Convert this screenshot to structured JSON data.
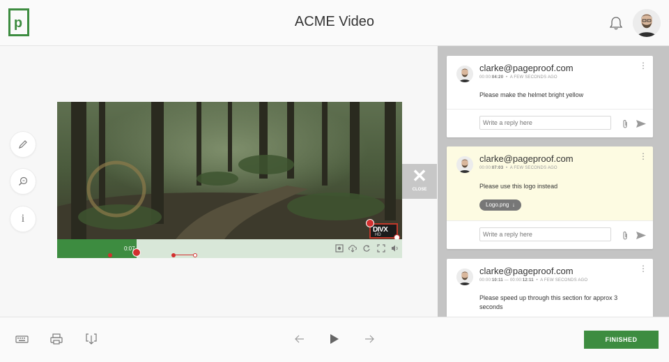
{
  "header": {
    "logo_letter": "p",
    "title": "ACME Video",
    "bell_icon": "bell-icon",
    "avatar_icon": "user-avatar"
  },
  "tools": [
    {
      "name": "pencil-icon"
    },
    {
      "name": "zoom-icon"
    },
    {
      "name": "info-icon"
    }
  ],
  "tools_info_glyph": "i",
  "video": {
    "current_time": "0:07",
    "progress_fraction": 0.23,
    "watermark_main": "DIVX",
    "watermark_sub": "HD",
    "controls": [
      "screenshot-icon",
      "download-icon",
      "loop-icon",
      "fullscreen-icon",
      "volume-icon"
    ]
  },
  "close_panel": {
    "glyph": "✕",
    "label": "CLOSE"
  },
  "comments": [
    {
      "author": "clarke@pageproof.com",
      "time_prefix": "00:00:",
      "time_bold": "04:20",
      "time_suffix": "",
      "age": "A FEW SECONDS AGO",
      "text": "Please make the helmet bright yellow",
      "reply_placeholder": "Write a reply here",
      "highlighted": false
    },
    {
      "author": "clarke@pageproof.com",
      "time_prefix": "00:00:",
      "time_bold": "07:03",
      "time_suffix": "",
      "age": "A FEW SECONDS AGO",
      "text": "Please use this logo instead",
      "attachment": "Logo.png",
      "reply_placeholder": "Write a reply here",
      "highlighted": true
    },
    {
      "author": "clarke@pageproof.com",
      "time_prefix": "00:00:",
      "time_bold": "10:11",
      "time_mid": " — 00:00:",
      "time_bold2": "12:11",
      "age": "A FEW SECONDS AGO",
      "text": "Please speed up through this section for approx 3 seconds",
      "highlighted": false
    }
  ],
  "footer": {
    "finished_label": "FINISHED",
    "icons": [
      "keyboard-icon",
      "print-icon",
      "download-icon",
      "arrow-left-icon",
      "play-icon",
      "arrow-right-icon"
    ]
  },
  "colors": {
    "brand_green": "#3d8c40",
    "marker_red": "#d32f2f",
    "highlight_card": "#fdfbe2"
  }
}
